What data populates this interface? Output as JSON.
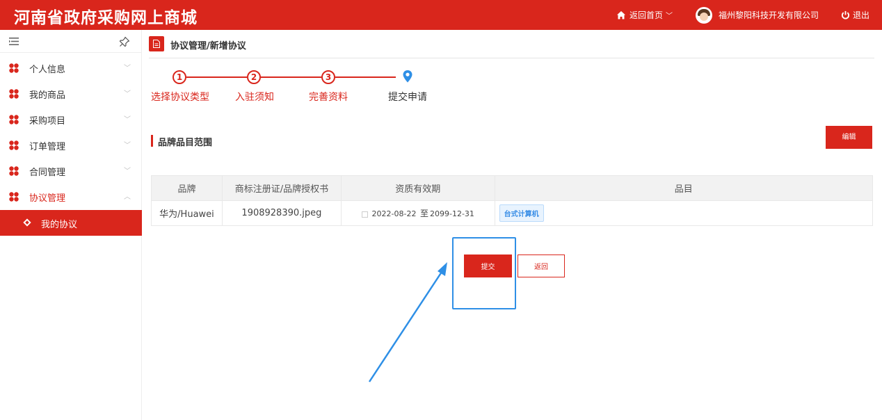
{
  "header": {
    "title": "河南省政府采购网上商城",
    "home_label": "返回首页",
    "user_name": "福州黎阳科技开发有限公司",
    "logout_label": "退出",
    "icons": [
      "home-icon",
      "chevron-down-icon",
      "avatar",
      "power-icon"
    ]
  },
  "sidebar": {
    "items": [
      {
        "label": "个人信息",
        "expanded": false
      },
      {
        "label": "我的商品",
        "expanded": false
      },
      {
        "label": "采购项目",
        "expanded": false
      },
      {
        "label": "订单管理",
        "expanded": false
      },
      {
        "label": "合同管理",
        "expanded": false
      },
      {
        "label": "协议管理",
        "expanded": true
      }
    ],
    "sub_item": {
      "label": "我的协议",
      "active": true
    }
  },
  "breadcrumb": "协议管理/新增协议",
  "steps": [
    {
      "number": "1",
      "label": "选择协议类型",
      "done": true
    },
    {
      "number": "2",
      "label": "入驻须知",
      "done": true
    },
    {
      "number": "3",
      "label": "完善资料",
      "done": true
    },
    {
      "number": "",
      "label": "提交申请",
      "done": false
    }
  ],
  "section": {
    "title": "品牌品目范围",
    "edit_label": "编辑"
  },
  "table": {
    "headers": [
      "品牌",
      "商标注册证/品牌授权书",
      "资质有效期",
      "品目"
    ],
    "rows": [
      {
        "brand": "华为/Huawei",
        "file": "1908928390.jpeg",
        "date_start": "2022-08-22",
        "date_sep": "至",
        "date_end": "2099-12-31",
        "category": "台式计算机"
      }
    ]
  },
  "actions": {
    "submit_label": "提交",
    "back_label": "返回"
  },
  "colors": {
    "brand_red": "#d9261c",
    "highlight_blue": "#2e8fe6"
  }
}
